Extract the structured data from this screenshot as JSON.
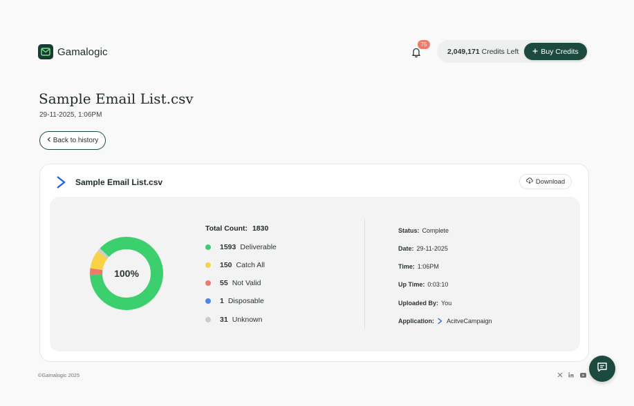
{
  "header": {
    "brand": "Gamalogic",
    "notification_count": "75",
    "credits_value": "2,049,171",
    "credits_label": "Credits Left",
    "buy_label": "Buy Credits"
  },
  "page": {
    "title": "Sample Email List.csv",
    "subtitle": "29-11-2025, 1:06PM",
    "back_label": "Back to history"
  },
  "card": {
    "file_name": "Sample Email List.csv",
    "download_label": "Download",
    "percent": "100%",
    "total_label": "Total Count:",
    "total_value": "1830",
    "legend": [
      {
        "count": "1593",
        "label": "Deliverable",
        "color": "#3ccf6e"
      },
      {
        "count": "150",
        "label": "Catch All",
        "color": "#f8d347"
      },
      {
        "count": "55",
        "label": "Not Valid",
        "color": "#f07a6a"
      },
      {
        "count": "1",
        "label": "Disposable",
        "color": "#4a86e8"
      },
      {
        "count": "31",
        "label": "Unknown",
        "color": "#cccccc"
      }
    ],
    "meta": {
      "status_label": "Status:",
      "status_value": "Complete",
      "date_label": "Date:",
      "date_value": "29-11-2025",
      "time_label": "Time:",
      "time_value": "1:06PM",
      "uptime_label": "Up Time:",
      "uptime_value": "0:03:10",
      "uploaded_label": "Uploaded By:",
      "uploaded_value": "You",
      "app_label": "Application:",
      "app_value": "AcitveCampaign"
    }
  },
  "chart_data": {
    "type": "pie",
    "categories": [
      "Deliverable",
      "Catch All",
      "Not Valid",
      "Disposable",
      "Unknown"
    ],
    "values": [
      1593,
      150,
      55,
      1,
      31
    ],
    "colors": [
      "#3ccf6e",
      "#f8d347",
      "#f07a6a",
      "#4a86e8",
      "#cccccc"
    ],
    "title": "",
    "center_label": "100%"
  },
  "footer": {
    "copyright": "©Gamalogic 2025"
  },
  "icons": {
    "logo": "mail-logo-icon",
    "bell": "bell-icon",
    "plus": "plus-icon",
    "back": "chevron-left-icon",
    "download": "cloud-download-icon",
    "activecampaign": "activecampaign-icon",
    "x": "x-icon",
    "linkedin": "linkedin-icon",
    "youtube": "youtube-icon",
    "chat": "chat-icon"
  }
}
